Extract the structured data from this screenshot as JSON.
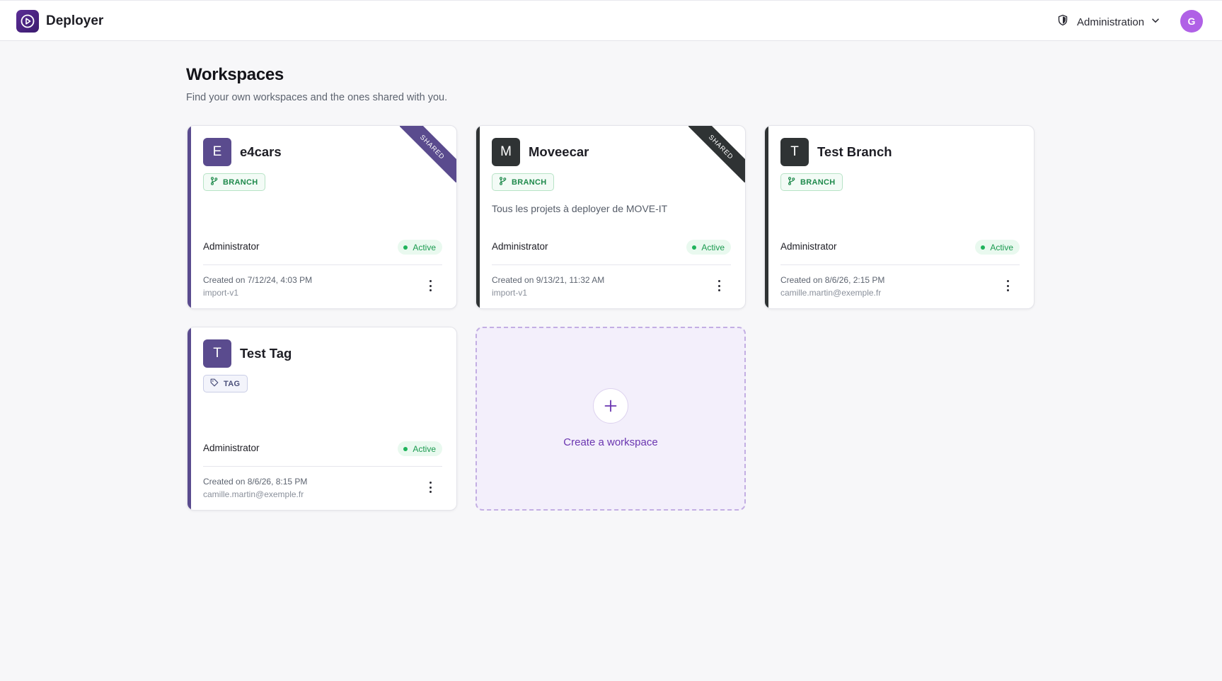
{
  "colors": {
    "accent": "#6a35b0",
    "purple_card": "#5a4b8e",
    "dark_card": "#2f3334",
    "active_green": "#1a9a4f"
  },
  "header": {
    "app_name": "Deployer",
    "admin_label": "Administration",
    "avatar_initial": "G"
  },
  "main": {
    "title": "Workspaces",
    "subtitle": "Find your own workspaces and the ones shared with you."
  },
  "workspaces": [
    {
      "initial": "E",
      "name": "e4cars",
      "badge": "BRANCH",
      "ribbon": "SHARED",
      "description": "",
      "role": "Administrator",
      "status": "Active",
      "created": "Created on 7/12/24, 4:03 PM",
      "sub": "import-v1"
    },
    {
      "initial": "M",
      "name": "Moveecar",
      "badge": "BRANCH",
      "ribbon": "SHARED",
      "description": "Tous les projets à deployer de MOVE-IT",
      "role": "Administrator",
      "status": "Active",
      "created": "Created on 9/13/21, 11:32 AM",
      "sub": "import-v1"
    },
    {
      "initial": "T",
      "name": "Test Branch",
      "badge": "BRANCH",
      "description": "",
      "role": "Administrator",
      "status": "Active",
      "created": "Created on 8/6/26, 2:15 PM",
      "sub": "camille.martin@exemple.fr"
    },
    {
      "initial": "T",
      "name": "Test Tag",
      "badge": "TAG",
      "description": "",
      "role": "Administrator",
      "status": "Active",
      "created": "Created on 8/6/26, 8:15 PM",
      "sub": "camille.martin@exemple.fr"
    }
  ],
  "create_card": {
    "label": "Create a workspace"
  }
}
